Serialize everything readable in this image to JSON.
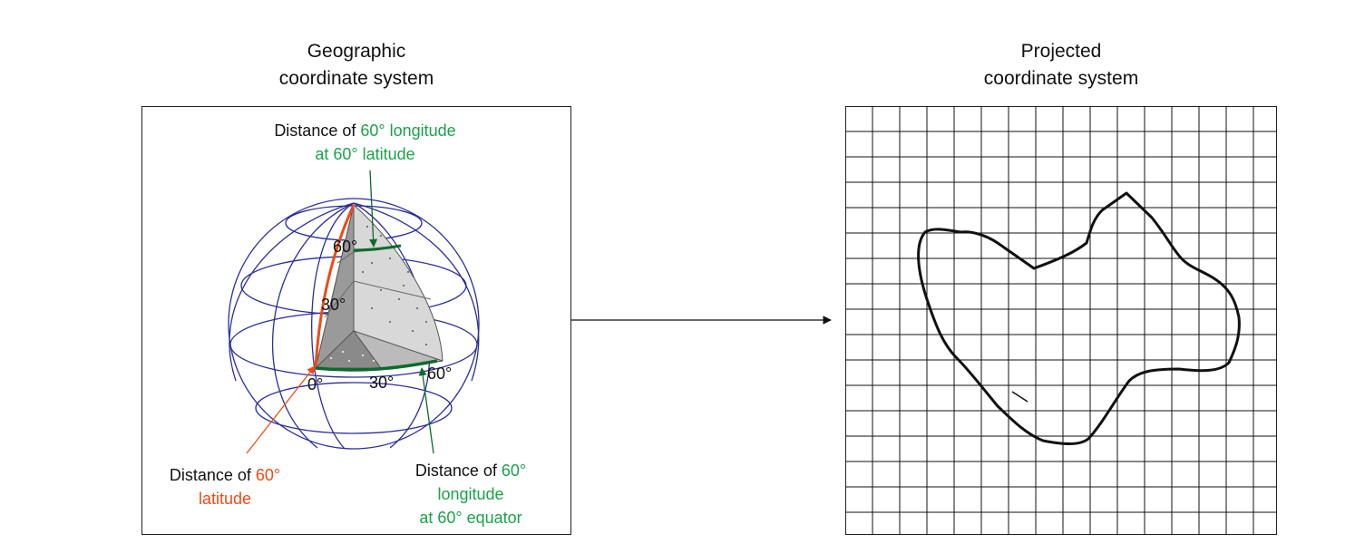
{
  "left": {
    "title_line1": "Geographic",
    "title_line2": "coordinate system",
    "top_label": {
      "black": "Distance of",
      "green1": "60° longitude",
      "green2": "at 60° latitude"
    },
    "bottom_left_label": {
      "black": "Distance of",
      "orange1": "60°",
      "orange2": "latitude"
    },
    "bottom_right_label": {
      "black": "Distance of",
      "green1": "60°",
      "green2": "longitude",
      "green3": "at 60° equator"
    },
    "degree_labels": {
      "lat_60": "60°",
      "lat_30": "30°",
      "lon_0": "0°",
      "lon_30": "30°",
      "lon_60": "60°"
    }
  },
  "right": {
    "title_line1": "Projected",
    "title_line2": "coordinate system"
  },
  "colors": {
    "globe_lines": "#2b2e9c",
    "green": "#1aa34a",
    "dark_green": "#0b6b2c",
    "orange": "#f04a14",
    "wedge_light": "#d4d4d4",
    "wedge_dark": "#9a9a9a"
  }
}
